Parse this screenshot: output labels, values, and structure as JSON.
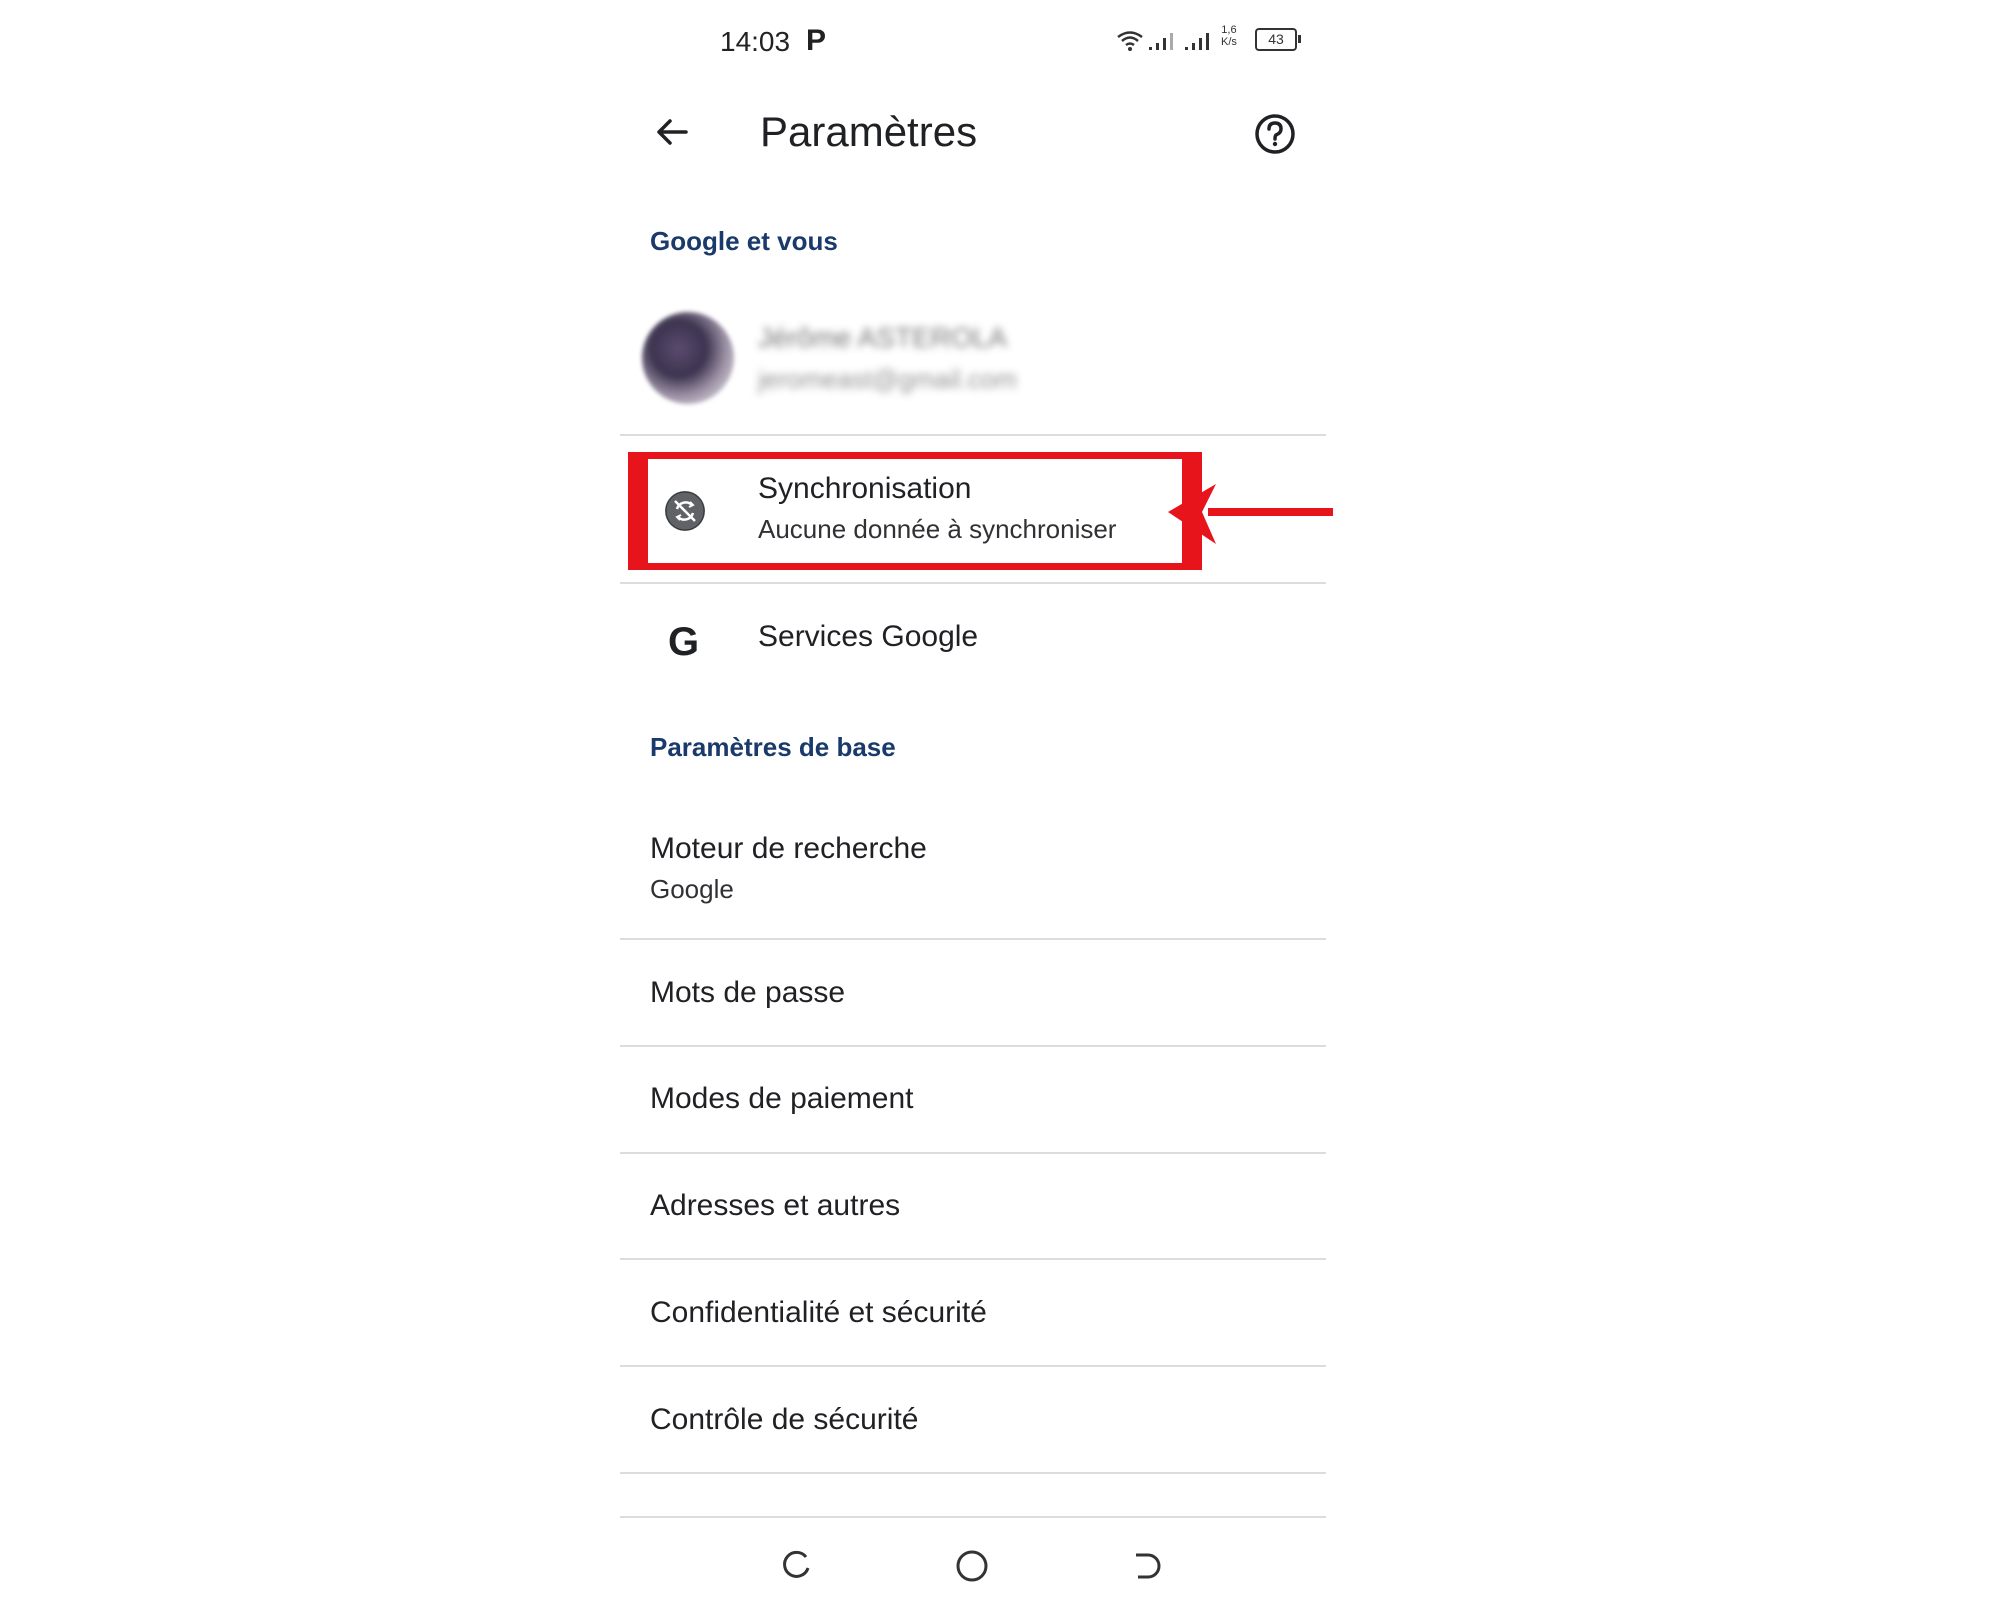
{
  "status_bar": {
    "time": "14:03",
    "p_icon": "P",
    "speed_top": "1,6",
    "speed_bottom": "K/s",
    "battery": "43",
    "icons": [
      "wifi-icon",
      "signal-icon",
      "signal-icon"
    ]
  },
  "app_bar": {
    "title": "Paramètres",
    "back_icon": "arrow-back-icon",
    "help_icon": "help-circle-icon"
  },
  "sections": {
    "google_header": "Google et vous",
    "basic_header": "Paramètres de base"
  },
  "account": {
    "name": "Jérôme ASTEROLA",
    "email": "jeromeast@gmail.com"
  },
  "sync": {
    "title": "Synchronisation",
    "subtitle": "Aucune donnée à synchroniser",
    "icon": "sync-off-icon",
    "highlight_color": "#e8141c"
  },
  "google_services": {
    "title": "Services Google",
    "icon": "G"
  },
  "search_engine": {
    "title": "Moteur de recherche",
    "subtitle": "Google"
  },
  "items": [
    "Mots de passe",
    "Modes de paiement",
    "Adresses et autres",
    "Confidentialité et sécurité",
    "Contrôle de sécurité"
  ],
  "nav_bar": [
    "recents-icon",
    "home-icon",
    "back-nav-icon"
  ]
}
